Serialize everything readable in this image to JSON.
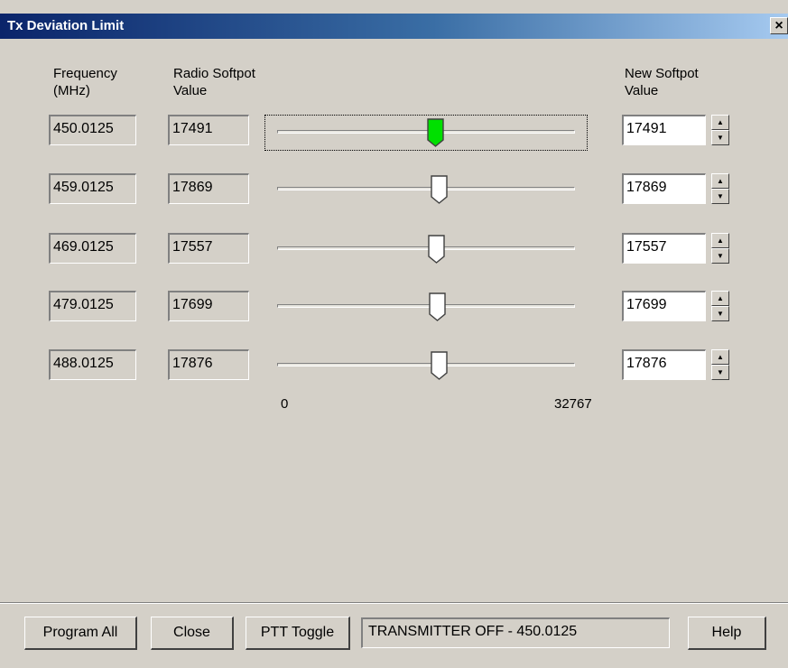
{
  "window": {
    "title": "Tx Deviation Limit",
    "close_glyph": "×"
  },
  "headers": {
    "frequency": [
      "Frequency",
      "(MHz)"
    ],
    "radio": [
      "Radio Softpot",
      "Value"
    ],
    "new": [
      "New Softpot",
      "Value"
    ]
  },
  "slider_range": {
    "min": 0,
    "max": 32767,
    "min_label": "0",
    "max_label": "32767"
  },
  "rows": [
    {
      "frequency": "450.0125",
      "radio_value": "17491",
      "new_value": "17491",
      "slider_value": 17491,
      "focused": true,
      "thumb_color": "#00e000"
    },
    {
      "frequency": "459.0125",
      "radio_value": "17869",
      "new_value": "17869",
      "slider_value": 17869,
      "focused": false,
      "thumb_color": "#ffffff"
    },
    {
      "frequency": "469.0125",
      "radio_value": "17557",
      "new_value": "17557",
      "slider_value": 17557,
      "focused": false,
      "thumb_color": "#ffffff"
    },
    {
      "frequency": "479.0125",
      "radio_value": "17699",
      "new_value": "17699",
      "slider_value": 17699,
      "focused": false,
      "thumb_color": "#ffffff"
    },
    {
      "frequency": "488.0125",
      "radio_value": "17876",
      "new_value": "17876",
      "slider_value": 17876,
      "focused": false,
      "thumb_color": "#ffffff"
    }
  ],
  "buttons": {
    "program_all": "Program All",
    "close": "Close",
    "ptt_toggle": "PTT Toggle",
    "help": "Help"
  },
  "status_text": "TRANSMITTER OFF - 450.0125",
  "spin_glyphs": {
    "up": "▲",
    "down": "▼"
  }
}
